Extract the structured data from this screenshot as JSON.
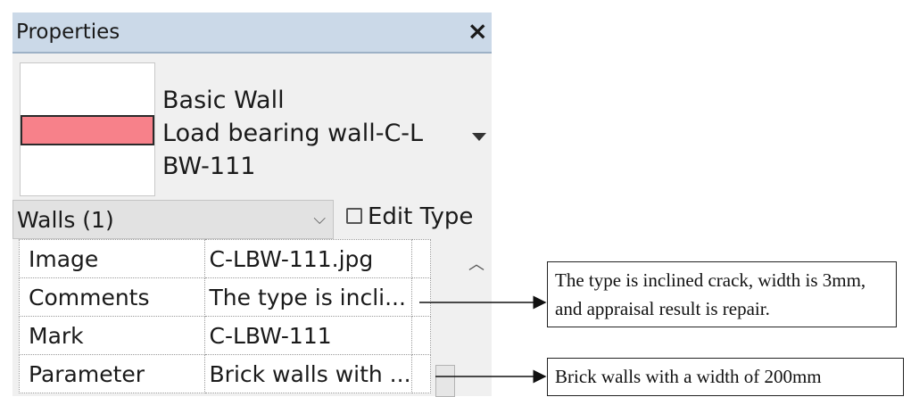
{
  "panel": {
    "title": "Properties",
    "close_glyph": "×",
    "type_selector": {
      "family": "Basic Wall",
      "type": "Load bearing wall-C-LBW-111"
    },
    "category_filter": "Walls (1)",
    "edit_type_label": "Edit Type",
    "colors": {
      "wall_swatch": "#f7818a",
      "header_bg": "#cbd9e8"
    }
  },
  "properties": {
    "rows": [
      {
        "name": "Image",
        "value": "C-LBW-111.jpg"
      },
      {
        "name": "Comments",
        "value": "The type is incli..."
      },
      {
        "name": "Mark",
        "value": "C-LBW-111"
      },
      {
        "name": "Parameter",
        "value": "Brick walls with ..."
      }
    ]
  },
  "callouts": {
    "comments": "The type is inclined crack, width is 3mm, and appraisal result is repair.",
    "parameter": "Brick walls with a width of 200mm"
  }
}
